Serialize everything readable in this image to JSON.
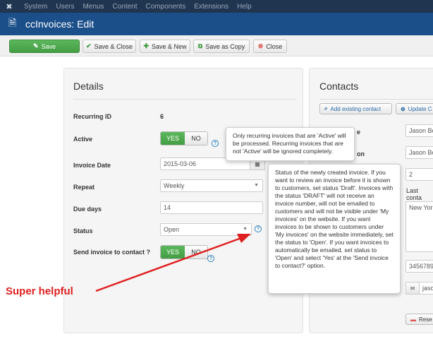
{
  "menubar": {
    "logo_icon": "joomla-logo-icon",
    "items": [
      "System",
      "Users",
      "Menus",
      "Content",
      "Components",
      "Extensions",
      "Help"
    ]
  },
  "titlebar": {
    "icon": "invoice-icon",
    "title": "ccInvoices: Edit"
  },
  "toolbar": {
    "save": "Save",
    "save_close": "Save & Close",
    "save_new": "Save & New",
    "save_copy": "Save as Copy",
    "close": "Close"
  },
  "details": {
    "title": "Details",
    "recurring_id_label": "Recurring ID",
    "recurring_id_value": "6",
    "active_label": "Active",
    "yes": "YES",
    "no": "NO",
    "invoice_date_label": "Invoice Date",
    "invoice_date_value": "2015-03-06",
    "repeat_label": "Repeat",
    "repeat_value": "Weekly",
    "due_days_label": "Due days",
    "due_days_value": "14",
    "status_label": "Status",
    "status_value": "Open",
    "send_label": "Send invoice to contact ?",
    "send_yes": "YES",
    "send_no": "NO"
  },
  "contacts": {
    "title": "Contacts",
    "add_existing": "Add existing contact",
    "update": "Update C",
    "field_labels": [
      "e",
      "on"
    ],
    "name1": "Jason Bo",
    "name2": "Jason Bo",
    "number": "2",
    "last_contact_label": "Last conta",
    "address": "New York",
    "phone": "3456789",
    "email": "jaso",
    "reset": "Rese"
  },
  "tooltips": {
    "active": "Only recurring invoices that are 'Active' will be processed. Recurring invoices that are not 'Active' will be ignored completely.",
    "status": "Status of the newly created invoice. If you want to review an invoice before it is shown to customers, set status 'Draft'. Invoices with the status 'DRAFT' will not receive an invoice number, will not be emailed to customers and will not be visible under 'My invoices' on the website. If you want invoices to be shown to customers under 'My invoices' on the website immediately, set the status to 'Open'. If you want invoices to automatically be emailed, set status to 'Open' and select 'Yes' at the 'Send invoice to contact?' option."
  },
  "annotation": {
    "text": "Super helpful",
    "color": "#e02020"
  },
  "colors": {
    "menubar": "#1f3550",
    "titlebar": "#1b4f8a",
    "success": "#5cb85c",
    "help": "#2a7ab8"
  }
}
